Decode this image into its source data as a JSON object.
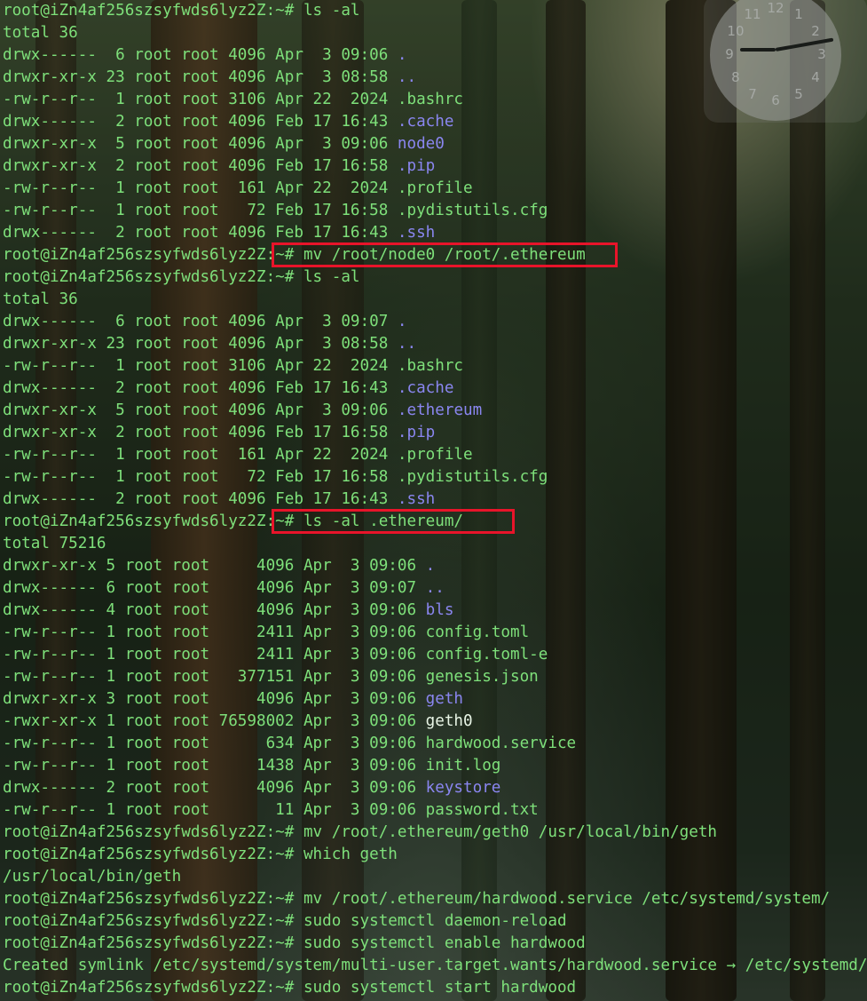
{
  "clock": {
    "numbers": [
      "12",
      "1",
      "2",
      "3",
      "4",
      "5",
      "6",
      "7",
      "8",
      "9",
      "10",
      "11"
    ]
  },
  "terminal": {
    "lines": [
      [
        {
          "t": "root@iZn4af256szsyfwds6lyz2Z:~# ls -al"
        }
      ],
      [
        {
          "t": "total 36"
        }
      ],
      [
        {
          "t": "drwx------  6 root root 4096 Apr  3 09:06 "
        },
        {
          "t": ".",
          "c": "dir"
        }
      ],
      [
        {
          "t": "drwxr-xr-x 23 root root 4096 Apr  3 08:58 "
        },
        {
          "t": "..",
          "c": "dir"
        }
      ],
      [
        {
          "t": "-rw-r--r--  1 root root 3106 Apr 22  2024 .bashrc"
        }
      ],
      [
        {
          "t": "drwx------  2 root root 4096 Feb 17 16:43 "
        },
        {
          "t": ".cache",
          "c": "dir"
        }
      ],
      [
        {
          "t": "drwxr-xr-x  5 root root 4096 Apr  3 09:06 "
        },
        {
          "t": "node0",
          "c": "dir"
        }
      ],
      [
        {
          "t": "drwxr-xr-x  2 root root 4096 Feb 17 16:58 "
        },
        {
          "t": ".pip",
          "c": "dir"
        }
      ],
      [
        {
          "t": "-rw-r--r--  1 root root  161 Apr 22  2024 .profile"
        }
      ],
      [
        {
          "t": "-rw-r--r--  1 root root   72 Feb 17 16:58 .pydistutils.cfg"
        }
      ],
      [
        {
          "t": "drwx------  2 root root 4096 Feb 17 16:43 "
        },
        {
          "t": ".ssh",
          "c": "dir"
        }
      ],
      [
        {
          "t": "root@iZn4af256szsyfwds6lyz2Z:~# mv /root/node0 /root/.ethereum"
        }
      ],
      [
        {
          "t": "root@iZn4af256szsyfwds6lyz2Z:~# ls -al"
        }
      ],
      [
        {
          "t": "total 36"
        }
      ],
      [
        {
          "t": "drwx------  6 root root 4096 Apr  3 09:07 "
        },
        {
          "t": ".",
          "c": "dir"
        }
      ],
      [
        {
          "t": "drwxr-xr-x 23 root root 4096 Apr  3 08:58 "
        },
        {
          "t": "..",
          "c": "dir"
        }
      ],
      [
        {
          "t": "-rw-r--r--  1 root root 3106 Apr 22  2024 .bashrc"
        }
      ],
      [
        {
          "t": "drwx------  2 root root 4096 Feb 17 16:43 "
        },
        {
          "t": ".cache",
          "c": "dir"
        }
      ],
      [
        {
          "t": "drwxr-xr-x  5 root root 4096 Apr  3 09:06 "
        },
        {
          "t": ".ethereum",
          "c": "dir"
        }
      ],
      [
        {
          "t": "drwxr-xr-x  2 root root 4096 Feb 17 16:58 "
        },
        {
          "t": ".pip",
          "c": "dir"
        }
      ],
      [
        {
          "t": "-rw-r--r--  1 root root  161 Apr 22  2024 .profile"
        }
      ],
      [
        {
          "t": "-rw-r--r--  1 root root   72 Feb 17 16:58 .pydistutils.cfg"
        }
      ],
      [
        {
          "t": "drwx------  2 root root 4096 Feb 17 16:43 "
        },
        {
          "t": ".ssh",
          "c": "dir"
        }
      ],
      [
        {
          "t": "root@iZn4af256szsyfwds6lyz2Z:~# ls -al .ethereum/"
        }
      ],
      [
        {
          "t": "total 75216"
        }
      ],
      [
        {
          "t": "drwxr-xr-x 5 root root     4096 Apr  3 09:06 "
        },
        {
          "t": ".",
          "c": "dir"
        }
      ],
      [
        {
          "t": "drwx------ 6 root root     4096 Apr  3 09:07 "
        },
        {
          "t": "..",
          "c": "dir"
        }
      ],
      [
        {
          "t": "drwx------ 4 root root     4096 Apr  3 09:06 "
        },
        {
          "t": "bls",
          "c": "dir"
        }
      ],
      [
        {
          "t": "-rw-r--r-- 1 root root     2411 Apr  3 09:06 config.toml"
        }
      ],
      [
        {
          "t": "-rw-r--r-- 1 root root     2411 Apr  3 09:06 config.toml-e"
        }
      ],
      [
        {
          "t": "-rw-r--r-- 1 root root   377151 Apr  3 09:06 genesis.json"
        }
      ],
      [
        {
          "t": "drwxr-xr-x 3 root root     4096 Apr  3 09:06 "
        },
        {
          "t": "geth",
          "c": "dir"
        }
      ],
      [
        {
          "t": "-rwxr-xr-x 1 root root 76598002 Apr  3 09:06 "
        },
        {
          "t": "geth0",
          "c": "exe"
        }
      ],
      [
        {
          "t": "-rw-r--r-- 1 root root      634 Apr  3 09:06 hardwood.service"
        }
      ],
      [
        {
          "t": "-rw-r--r-- 1 root root     1438 Apr  3 09:06 init.log"
        }
      ],
      [
        {
          "t": "drwx------ 2 root root     4096 Apr  3 09:06 "
        },
        {
          "t": "keystore",
          "c": "dir"
        }
      ],
      [
        {
          "t": "-rw-r--r-- 1 root root       11 Apr  3 09:06 password.txt"
        }
      ],
      [
        {
          "t": "root@iZn4af256szsyfwds6lyz2Z:~# mv /root/.ethereum/geth0 /usr/local/bin/geth"
        }
      ],
      [
        {
          "t": "root@iZn4af256szsyfwds6lyz2Z:~# which geth"
        }
      ],
      [
        {
          "t": "/usr/local/bin/geth"
        }
      ],
      [
        {
          "t": "root@iZn4af256szsyfwds6lyz2Z:~# mv /root/.ethereum/hardwood.service /etc/systemd/system/"
        }
      ],
      [
        {
          "t": "root@iZn4af256szsyfwds6lyz2Z:~# sudo systemctl daemon-reload"
        }
      ],
      [
        {
          "t": "root@iZn4af256szsyfwds6lyz2Z:~# sudo systemctl enable hardwood"
        }
      ],
      [
        {
          "t": "Created symlink /etc/systemd/system/multi-user.target.wants/hardwood.service → /etc/systemd/system/hardwood.service."
        }
      ],
      [
        {
          "t": "root@iZn4af256szsyfwds6lyz2Z:~# sudo systemctl start hardwood"
        }
      ]
    ]
  },
  "highlights": [
    {
      "name": "highlight-mv-command",
      "line": 11
    },
    {
      "name": "highlight-ls-ethereum-command",
      "line": 23
    }
  ],
  "colors": {
    "text": "#7ee07a",
    "directory": "#8a86f0",
    "executable": "#e8f5e6",
    "highlight_border": "#e8142a"
  }
}
